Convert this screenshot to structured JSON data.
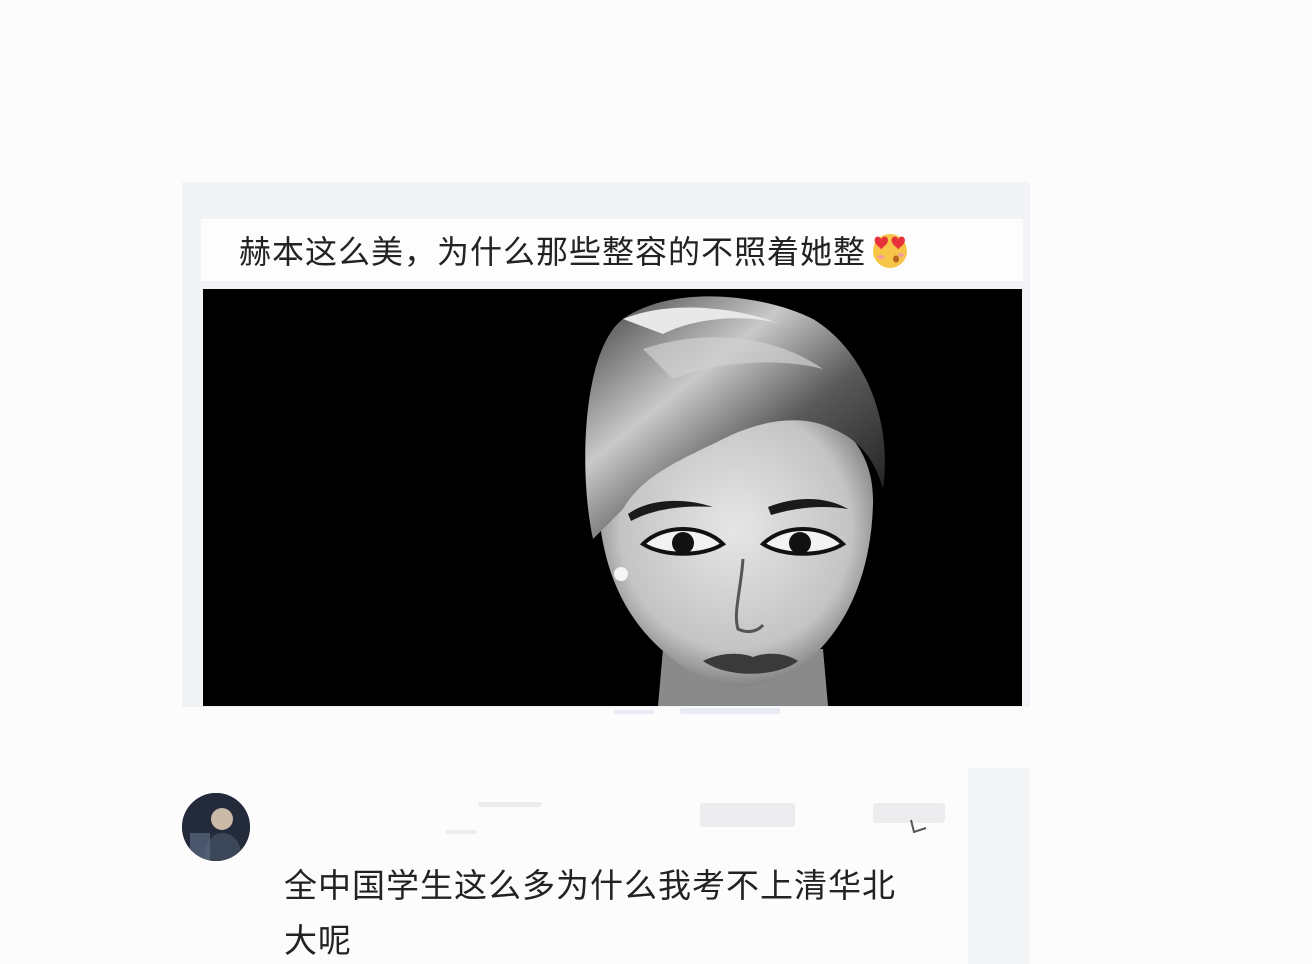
{
  "post": {
    "caption": "赫本这么美，为什么那些整容的不照着她整",
    "caption_emoji": "heart-eyes-emoji"
  },
  "comment": {
    "text_line1": "全中国学生这么多为什么我考不上清华北",
    "text_line2": "大呢"
  },
  "colors": {
    "page_bg": "#fcfcfd",
    "card_bg": "#f2f3f6",
    "photo_bg": "#000000",
    "text": "#222222"
  }
}
